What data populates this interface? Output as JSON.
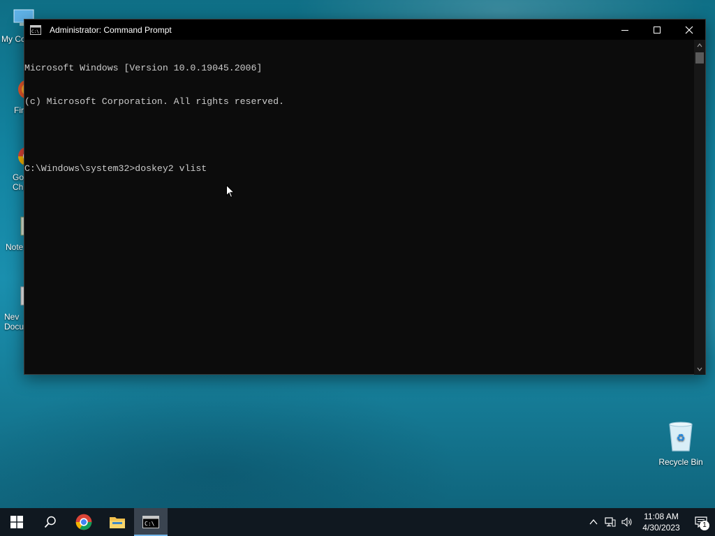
{
  "window": {
    "title": "Administrator: Command Prompt",
    "controls": [
      "minimize",
      "maximize",
      "close"
    ]
  },
  "console": {
    "lines": [
      "Microsoft Windows [Version 10.0.19045.2006]",
      "(c) Microsoft Corporation. All rights reserved.",
      "",
      "C:\\Windows\\system32>doskey2 vlist"
    ],
    "text_color": "#cccccc",
    "background_color": "#0c0c0c"
  },
  "desktop": {
    "icons": [
      {
        "label": "My Co",
        "icon": "computer-icon"
      },
      {
        "label": "Fir",
        "icon": "firefox-icon"
      },
      {
        "label": "Go\nChr",
        "icon": "chrome-icon"
      },
      {
        "label": "Note",
        "icon": "notepad-icon"
      },
      {
        "label": "Nev\nDocu",
        "icon": "document-icon"
      }
    ],
    "recycle_bin": {
      "label": "Recycle Bin",
      "icon": "recycle-bin-icon"
    }
  },
  "taskbar": {
    "items": [
      {
        "name": "start",
        "icon": "windows-logo-icon"
      },
      {
        "name": "search",
        "icon": "search-icon"
      },
      {
        "name": "chrome",
        "icon": "chrome-icon"
      },
      {
        "name": "file-explorer",
        "icon": "folder-icon"
      },
      {
        "name": "command-prompt",
        "icon": "cmd-icon",
        "active": true
      }
    ],
    "tray": {
      "time": "11:08 AM",
      "date": "4/30/2023",
      "notification_count": "1"
    }
  },
  "colors": {
    "taskbar": "#101820",
    "active_indicator": "#76b9ed",
    "desktop_accent": "#1283a0"
  }
}
